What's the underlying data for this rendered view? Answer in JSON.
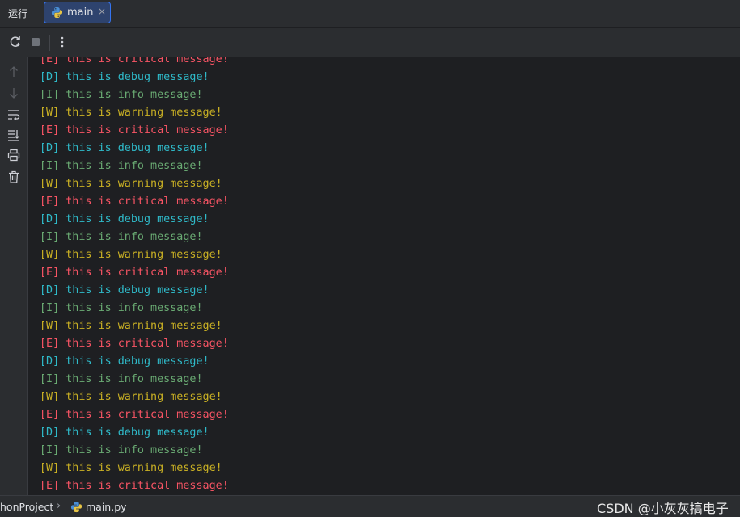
{
  "header": {
    "run_title": "运行",
    "tab": {
      "label": "main",
      "close": "×"
    }
  },
  "toolbar": {
    "rerun_icon": "rerun-icon",
    "stop_icon": "stop-icon",
    "more_icon": "more-vertical-icon"
  },
  "gutter": {
    "icons": [
      "arrow-up-icon",
      "arrow-down-icon",
      "soft-wrap-icon",
      "scroll-to-end-icon",
      "print-icon",
      "trash-icon"
    ]
  },
  "console": {
    "lines": [
      {
        "level": "E",
        "text": "[E] this is critical message!"
      },
      {
        "level": "D",
        "text": "[D] this is debug message!"
      },
      {
        "level": "I",
        "text": "[I] this is info message!"
      },
      {
        "level": "W",
        "text": "[W] this is warning message!"
      },
      {
        "level": "E",
        "text": "[E] this is critical message!"
      },
      {
        "level": "D",
        "text": "[D] this is debug message!"
      },
      {
        "level": "I",
        "text": "[I] this is info message!"
      },
      {
        "level": "W",
        "text": "[W] this is warning message!"
      },
      {
        "level": "E",
        "text": "[E] this is critical message!"
      },
      {
        "level": "D",
        "text": "[D] this is debug message!"
      },
      {
        "level": "I",
        "text": "[I] this is info message!"
      },
      {
        "level": "W",
        "text": "[W] this is warning message!"
      },
      {
        "level": "E",
        "text": "[E] this is critical message!"
      },
      {
        "level": "D",
        "text": "[D] this is debug message!"
      },
      {
        "level": "I",
        "text": "[I] this is info message!"
      },
      {
        "level": "W",
        "text": "[W] this is warning message!"
      },
      {
        "level": "E",
        "text": "[E] this is critical message!"
      },
      {
        "level": "D",
        "text": "[D] this is debug message!"
      },
      {
        "level": "I",
        "text": "[I] this is info message!"
      },
      {
        "level": "W",
        "text": "[W] this is warning message!"
      },
      {
        "level": "E",
        "text": "[E] this is critical message!"
      },
      {
        "level": "D",
        "text": "[D] this is debug message!"
      },
      {
        "level": "I",
        "text": "[I] this is info message!"
      },
      {
        "level": "W",
        "text": "[W] this is warning message!"
      },
      {
        "level": "E",
        "text": "[E] this is critical message!"
      }
    ]
  },
  "statusbar": {
    "project": "honProject",
    "chevron": "›",
    "file": "main.py",
    "watermark": "CSDN @小灰灰搞电子"
  },
  "colors": {
    "critical": "#f75464",
    "debug": "#2fbac9",
    "info": "#6aab73",
    "warning": "#c9b024",
    "accent": "#3574f0"
  }
}
